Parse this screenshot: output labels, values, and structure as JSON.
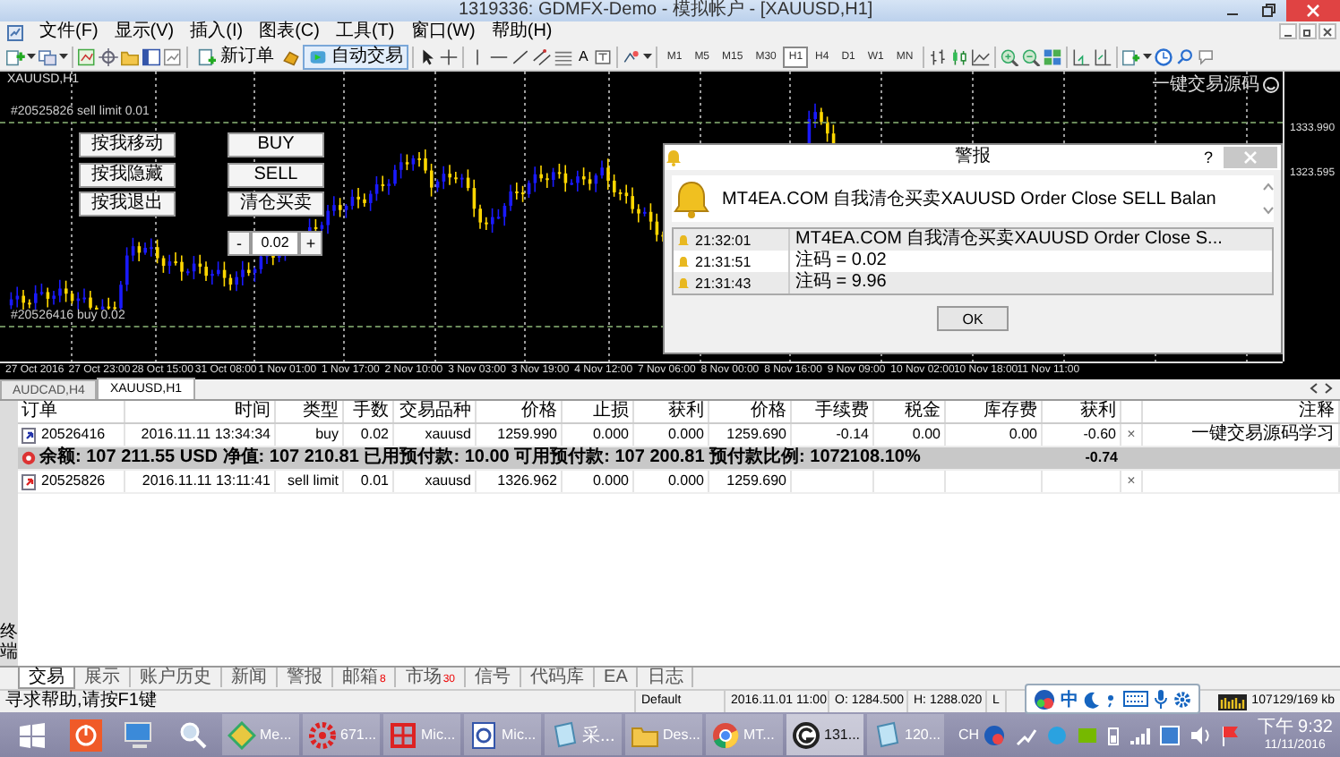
{
  "window": {
    "title": "1319336: GDMFX-Demo - 模拟帐户 - [XAUUSD,H1]"
  },
  "menu": [
    "文件(F)",
    "显示(V)",
    "插入(I)",
    "图表(C)",
    "工具(T)",
    "窗口(W)",
    "帮助(H)"
  ],
  "toolbar": {
    "new_order": "新订单",
    "auto_trading": {
      "label": "自动交易",
      "on": true
    },
    "text_tool": "A",
    "timeframes": [
      {
        "label": "M1",
        "selected": false
      },
      {
        "label": "M5",
        "selected": false
      },
      {
        "label": "M15",
        "selected": false
      },
      {
        "label": "M30",
        "selected": false
      },
      {
        "label": "H1",
        "selected": true
      },
      {
        "label": "H4",
        "selected": false
      },
      {
        "label": "D1",
        "selected": false
      },
      {
        "label": "W1",
        "selected": false
      },
      {
        "label": "MN",
        "selected": false
      }
    ]
  },
  "chart": {
    "symbol": "XAUUSD,H1",
    "corner_label": "一键交易源码",
    "order_lines": [
      {
        "label": "#20525826 sell limit 0.01"
      },
      {
        "label": "#20526416 buy 0.02"
      }
    ],
    "left_buttons": [
      "按我移动",
      "按我隐藏",
      "按我退出"
    ],
    "right_buttons": [
      "BUY",
      "SELL",
      "清仓买卖"
    ],
    "lot": {
      "minus": "-",
      "value": "0.02",
      "plus": "+"
    },
    "price_labels": [
      "1333.990",
      "1323.595"
    ],
    "time_labels": [
      "27 Oct 2016",
      "27 Oct 23:00",
      "28 Oct 15:00",
      "31 Oct 08:00",
      "1 Nov 01:00",
      "1 Nov 17:00",
      "2 Nov 10:00",
      "3 Nov 03:00",
      "3 Nov 19:00",
      "4 Nov 12:00",
      "7 Nov 06:00",
      "8 Nov 00:00",
      "8 Nov 16:00",
      "9 Nov 09:00",
      "10 Nov 02:00",
      "10 Nov 18:00",
      "11 Nov 11:00"
    ]
  },
  "alert_dialog": {
    "title": "警报",
    "help": "?",
    "message": "MT4EA.COM 自我清仓买卖XAUUSD Order Close SELL Balan",
    "log": [
      {
        "time": "21:32:01",
        "text": "MT4EA.COM 自我清仓买卖XAUUSD Order Close S..."
      },
      {
        "time": "21:31:51",
        "text": "注码 = 0.02"
      },
      {
        "time": "21:31:43",
        "text": "注码 = 9.96"
      }
    ],
    "ok": "OK"
  },
  "chart_tabs": [
    {
      "label": "AUDCAD,H4",
      "selected": false
    },
    {
      "label": "XAUUSD,H1",
      "selected": true
    }
  ],
  "terminal": {
    "side_label": "终端",
    "columns": [
      "订单",
      "时间",
      "类型",
      "手数",
      "交易品种",
      "价格",
      "止损",
      "获利",
      "价格",
      "手续费",
      "税金",
      "库存费",
      "获利",
      "注释"
    ],
    "rows": [
      {
        "kind": "order",
        "pending": false,
        "cells": [
          "20526416",
          "2016.11.11 13:34:34",
          "buy",
          "0.02",
          "xauusd",
          "1259.990",
          "0.000",
          "0.000",
          "1259.690",
          "-0.14",
          "0.00",
          "0.00",
          "-0.60"
        ],
        "close": "×",
        "comment": "一键交易源码学习"
      },
      {
        "kind": "summary",
        "text": "余额: 107 211.55 USD  净值: 107 210.81  已用预付款: 10.00  可用预付款: 107 200.81  预付款比例: 1072108.10%",
        "total": "-0.74"
      },
      {
        "kind": "order",
        "pending": true,
        "cells": [
          "20525826",
          "2016.11.11 13:11:41",
          "sell limit",
          "0.01",
          "xauusd",
          "1326.962",
          "0.000",
          "0.000",
          "1259.690"
        ],
        "close": "×"
      }
    ],
    "tabs": [
      {
        "label": "交易",
        "selected": true
      },
      {
        "label": "展示",
        "selected": false
      },
      {
        "label": "账户历史",
        "selected": false
      },
      {
        "label": "新闻",
        "selected": false
      },
      {
        "label": "警报",
        "selected": false
      },
      {
        "label": "邮箱",
        "badge": "8",
        "selected": false
      },
      {
        "label": "市场",
        "badge": "30",
        "selected": false
      },
      {
        "label": "信号",
        "selected": false
      },
      {
        "label": "代码库",
        "selected": false
      },
      {
        "label": "EA",
        "selected": false
      },
      {
        "label": "日志",
        "selected": false
      }
    ]
  },
  "status_bar": [
    "寻求帮助,请按F1键",
    "Default",
    "2016.11.01 11:00",
    "O: 1284.500",
    "H: 1288.020",
    "L",
    "107129/169 kb"
  ],
  "ime_bar": {
    "mode": "中"
  },
  "taskbar": {
    "apps": [
      {
        "label": "Me...",
        "kind": "gem",
        "active": false
      },
      {
        "label": "671...",
        "kind": "gear",
        "active": false
      },
      {
        "label": "Mic...",
        "kind": "brush",
        "active": false
      },
      {
        "label": "Mic...",
        "kind": "doc",
        "active": false
      },
      {
        "label": "采...",
        "kind": "notepad",
        "active": false
      },
      {
        "label": "Des...",
        "kind": "folder",
        "active": false
      },
      {
        "label": "MT...",
        "kind": "chrome",
        "active": false
      },
      {
        "label": "131...",
        "kind": "circle",
        "active": true
      },
      {
        "label": "120...",
        "kind": "notepad",
        "active": false
      }
    ],
    "language": "CH",
    "time": "下午 9:32",
    "date": "11/11/2016"
  }
}
